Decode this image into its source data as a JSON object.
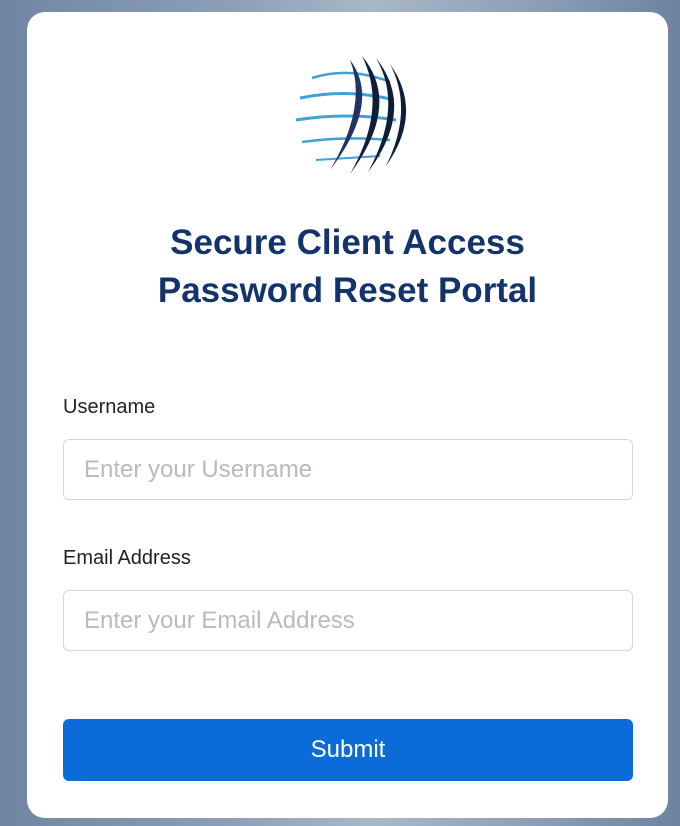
{
  "header": {
    "logo_icon": "globe-swoosh-icon",
    "title_line1": "Secure Client Access",
    "title_line2": "Password Reset Portal"
  },
  "form": {
    "username_label": "Username",
    "username_placeholder": "Enter your Username",
    "username_value": "",
    "email_label": "Email Address",
    "email_placeholder": "Enter your Email Address",
    "email_value": "",
    "submit_label": "Submit"
  },
  "colors": {
    "title": "#14336a",
    "button": "#0b6bd8",
    "logo_dark": "#0f1e38",
    "logo_light": "#3ea2d6"
  }
}
